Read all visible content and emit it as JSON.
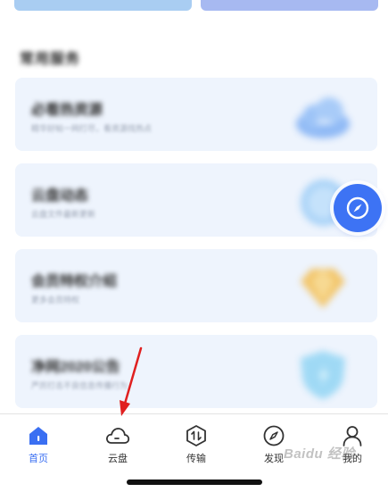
{
  "colors": {
    "accent": "#3a6ff2",
    "card_bg": "#eef4fd",
    "annotation_arrow": "#e02020"
  },
  "section": {
    "title": "常用服务"
  },
  "services": [
    {
      "title": "必看热资源",
      "desc": "精华好帖一网打尽，看资源找热点",
      "icon": "cloud-illustration"
    },
    {
      "title": "云盘动态",
      "desc": "云盘文件最新更新",
      "icon": "clock-illustration"
    },
    {
      "title": "会员特权介绍",
      "desc": "更多会员特权",
      "icon": "diamond-illustration"
    },
    {
      "title": "净网2020公告",
      "desc": "严厉打击不良信息传播行为",
      "icon": "shield-illustration"
    }
  ],
  "tabbar": {
    "tabs": [
      {
        "label": "首页",
        "icon": "home-icon",
        "active": true
      },
      {
        "label": "云盘",
        "icon": "cloud-icon",
        "active": false
      },
      {
        "label": "传输",
        "icon": "transfer-icon",
        "active": false
      },
      {
        "label": "发现",
        "icon": "compass-icon",
        "active": false
      },
      {
        "label": "我的",
        "icon": "person-icon",
        "active": false
      }
    ]
  },
  "watermark": "Baidu 经验"
}
